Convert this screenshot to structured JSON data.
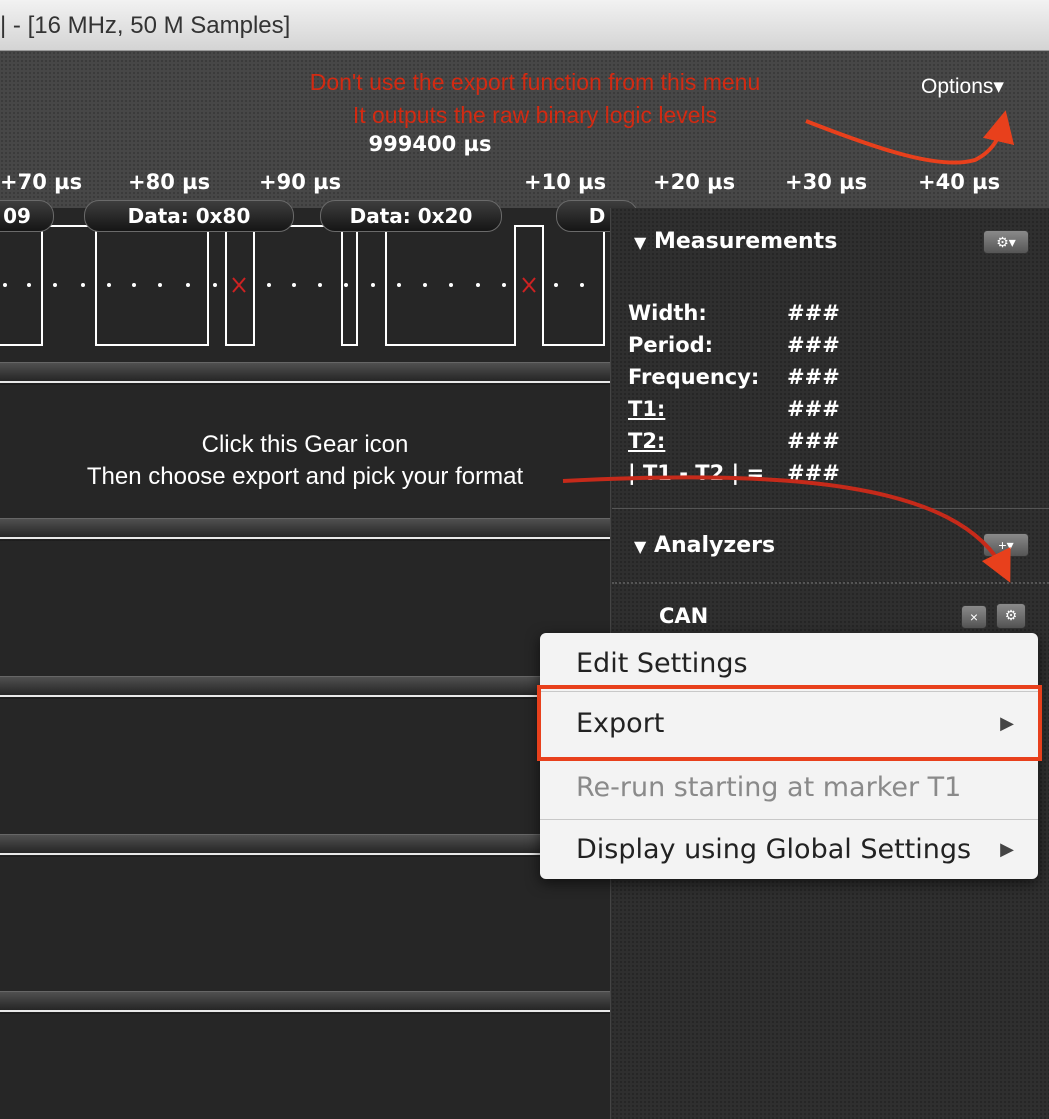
{
  "window": {
    "title": "| - [16 MHz, 50 M Samples]"
  },
  "header": {
    "annotation_line1": "Don't use the export function from this menu",
    "annotation_line2": "It outputs the raw binary logic levels",
    "timestamp": "999400 µs",
    "options_label": "Options▾"
  },
  "timeline": {
    "ticks": [
      "+70 µs",
      "+80 µs",
      "+90 µs",
      "+10 µs",
      "+20 µs",
      "+30 µs",
      "+40 µs"
    ]
  },
  "decoded": {
    "frames": [
      "09",
      "Data: 0x80",
      "Data: 0x20",
      "D"
    ]
  },
  "channel_annotation": {
    "line1": "Click this Gear icon",
    "line2": "Then choose export and pick your format"
  },
  "measurements": {
    "title": "Measurements",
    "rows": [
      {
        "label": "Width:",
        "value": "###"
      },
      {
        "label": "Period:",
        "value": "###"
      },
      {
        "label": "Frequency:",
        "value": "###"
      },
      {
        "label": "T1:",
        "value": "###"
      },
      {
        "label": "T2:",
        "value": "###"
      },
      {
        "label": "| T1 - T2 | =",
        "value": "###"
      }
    ]
  },
  "analyzers": {
    "title": "Analyzers",
    "items": [
      {
        "name": "CAN"
      }
    ]
  },
  "context_menu": {
    "items": [
      {
        "label": "Edit Settings",
        "submenu": false,
        "disabled": false
      },
      {
        "label": "Export",
        "submenu": true,
        "disabled": false,
        "highlighted": true
      },
      {
        "label": "Re-run starting at marker T1",
        "submenu": false,
        "disabled": true
      },
      {
        "label": "Display using Global Settings",
        "submenu": true,
        "disabled": false
      }
    ]
  },
  "colors": {
    "annotation_red": "#d22a12",
    "highlight_box": "#e8401c",
    "glitch_marker": "#cc2222"
  }
}
